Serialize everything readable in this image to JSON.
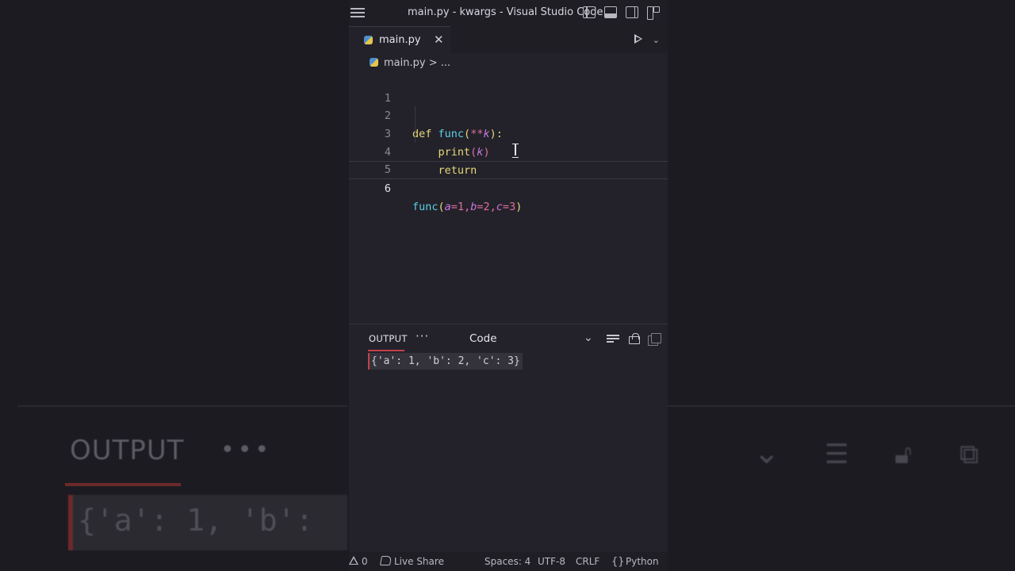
{
  "window": {
    "title": "main.py - kwargs - Visual Studio Code"
  },
  "tab": {
    "label": "main.py",
    "close": "✕"
  },
  "breadcrumb": {
    "file": "main.py",
    "more": "> ..."
  },
  "editor": {
    "line_numbers": [
      "1",
      "2",
      "3",
      "4",
      "5",
      "6"
    ],
    "active_line": "6",
    "lines": [
      {
        "text": ""
      },
      {
        "tokens": [
          "def",
          " ",
          "func",
          "(",
          "**",
          "k",
          "):"
        ]
      },
      {
        "tokens": [
          "    ",
          "print",
          "(",
          "k",
          ")"
        ]
      },
      {
        "tokens": [
          "    ",
          "return"
        ]
      },
      {
        "text": ""
      },
      {
        "tokens": [
          "func",
          "(",
          "a",
          "=",
          "1",
          ",",
          "b",
          "=",
          "2",
          ",",
          "c",
          "=",
          "3",
          ")"
        ]
      }
    ]
  },
  "panel": {
    "tab": "OUTPUT",
    "more": "···",
    "channel": "Code",
    "output": "{'a': 1, 'b': 2, 'c': 3}"
  },
  "statusbar": {
    "problems": "0",
    "live_share": "Live Share",
    "spaces": "Spaces: 4",
    "encoding": "UTF-8",
    "eol": "CRLF",
    "language": "Python"
  },
  "background": {
    "output": "OUTPUT",
    "dots": "•••",
    "code": "{'a': 1, 'b':"
  },
  "colors": {
    "accent_underline": "#c2414b",
    "keyword": "#e7d97a",
    "function": "#5ccfe6",
    "number": "#e06c9f",
    "param": "#c678dd"
  }
}
